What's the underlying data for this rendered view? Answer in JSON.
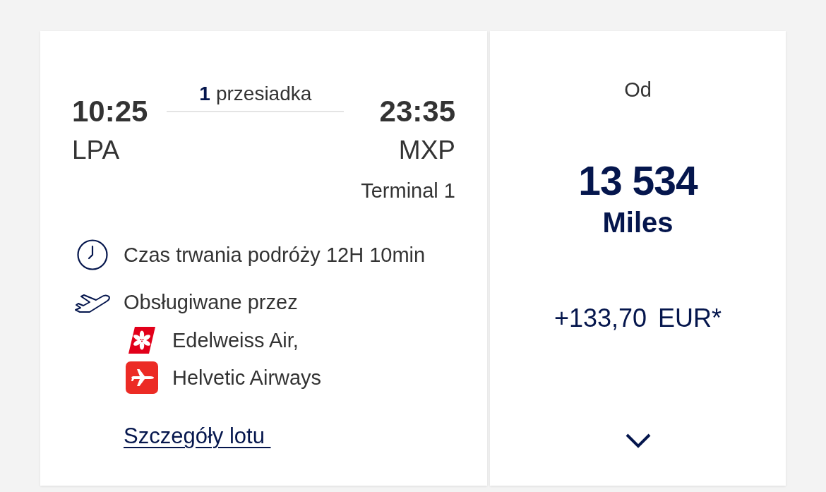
{
  "itinerary": {
    "departure": {
      "time": "10:25",
      "airport": "LPA"
    },
    "stops": {
      "count": "1",
      "label": "przesiadka"
    },
    "arrival": {
      "time": "23:35",
      "airport": "MXP",
      "terminal": "Terminal 1"
    }
  },
  "facts": [
    {
      "kind": "duration",
      "text": "Czas trwania podróży 12H 10min"
    },
    {
      "kind": "operator",
      "text": "Obsługiwane przez"
    }
  ],
  "airlines": [
    {
      "kind": "flower",
      "name": "Edelweiss Air,"
    },
    {
      "kind": "plane",
      "name": "Helvetic Airways"
    }
  ],
  "details_link": "Szczegóły lotu ",
  "fare": {
    "prefix": "Od",
    "miles": "13 534",
    "unit": "Miles",
    "amount": "+133,70",
    "currency": "EUR*",
    "expanded": false
  }
}
